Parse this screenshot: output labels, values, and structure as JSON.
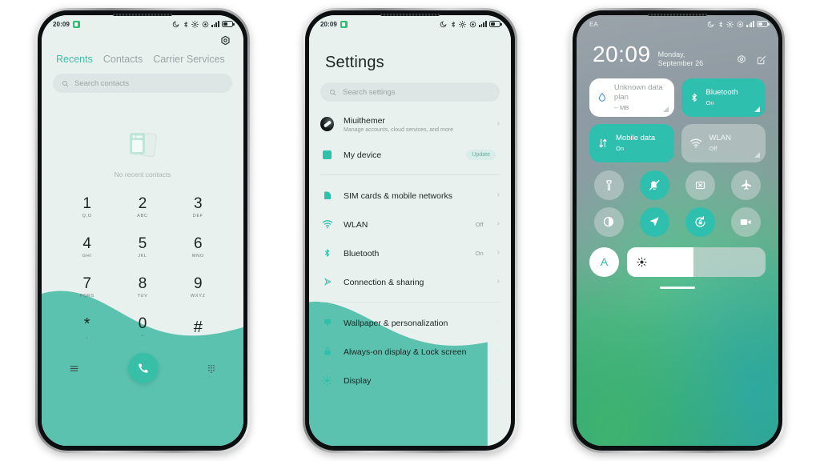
{
  "phone_dialer": {
    "status_bar": {
      "time": "20:09",
      "icons": [
        "dnd-moon-icon",
        "bluetooth-icon",
        "settings-gear-icon",
        "sync-ring-icon",
        "signal-bars-icon",
        "battery-icon"
      ]
    },
    "settings_gear_label": "settings-gear",
    "tabs": [
      {
        "label": "Recents",
        "active": true
      },
      {
        "label": "Contacts",
        "active": false
      },
      {
        "label": "Carrier Services",
        "active": false
      }
    ],
    "search_placeholder": "Search contacts",
    "empty_state": "No recent contacts",
    "keys": [
      {
        "num": "1",
        "sub": "Q,O"
      },
      {
        "num": "2",
        "sub": "ABC"
      },
      {
        "num": "3",
        "sub": "DEF"
      },
      {
        "num": "4",
        "sub": "GHI"
      },
      {
        "num": "5",
        "sub": "JKL"
      },
      {
        "num": "6",
        "sub": "MNO"
      },
      {
        "num": "7",
        "sub": "PQRS"
      },
      {
        "num": "8",
        "sub": "TUV"
      },
      {
        "num": "9",
        "sub": "WXYZ"
      },
      {
        "num": "*",
        "sub": ","
      },
      {
        "num": "0",
        "sub": "+"
      },
      {
        "num": "#",
        "sub": ""
      }
    ],
    "bottom_bar": {
      "menu": "menu-icon",
      "call": "call-icon",
      "keypad": "keypad-icon"
    }
  },
  "phone_settings": {
    "status_bar": {
      "time": "20:09"
    },
    "title": "Settings",
    "search_placeholder": "Search settings",
    "account": {
      "name": "Miuithemer",
      "subtitle": "Manage accounts, cloud services, and more"
    },
    "device": {
      "label": "My device",
      "badge": "Update"
    },
    "items": [
      {
        "label": "SIM cards & mobile networks",
        "value": "",
        "icon": "sim-card-icon"
      },
      {
        "label": "WLAN",
        "value": "Off",
        "icon": "wifi-icon"
      },
      {
        "label": "Bluetooth",
        "value": "On",
        "icon": "bluetooth-icon"
      },
      {
        "label": "Connection & sharing",
        "value": "",
        "icon": "connection-sharing-icon"
      }
    ],
    "items2": [
      {
        "label": "Wallpaper & personalization",
        "value": "",
        "icon": "wallpaper-icon"
      },
      {
        "label": "Always-on display & Lock screen",
        "value": "",
        "icon": "lock-icon"
      },
      {
        "label": "Display",
        "value": "",
        "icon": "brightness-icon"
      }
    ]
  },
  "phone_control_center": {
    "status_bar": {
      "carrier": "EA",
      "icons": [
        "dnd-moon-icon",
        "bluetooth-icon",
        "settings-gear-icon",
        "sync-ring-icon",
        "signal-bars-icon",
        "battery-icon"
      ]
    },
    "clock": "20:09",
    "date": "Monday, September 26",
    "header_icons": [
      "settings-gear-icon",
      "edit-icon"
    ],
    "tiles": [
      {
        "title": "Unknown data plan",
        "subtitle": "-- MB",
        "state": "white",
        "icon": "data-drop-icon"
      },
      {
        "title": "Bluetooth",
        "subtitle": "On",
        "state": "on",
        "icon": "bluetooth-icon"
      },
      {
        "title": "Mobile data",
        "subtitle": "On",
        "state": "on",
        "icon": "mobile-data-icon"
      },
      {
        "title": "WLAN",
        "subtitle": "Off",
        "state": "off",
        "icon": "wifi-icon"
      }
    ],
    "toggles": [
      {
        "name": "flashlight",
        "on": false
      },
      {
        "name": "silent-mode",
        "on": true
      },
      {
        "name": "cast-screen",
        "on": false
      },
      {
        "name": "airplane-mode",
        "on": false
      },
      {
        "name": "dark-mode",
        "on": false
      },
      {
        "name": "location",
        "on": true
      },
      {
        "name": "auto-rotate",
        "on": true
      },
      {
        "name": "screen-recorder",
        "on": false
      }
    ],
    "brightness": {
      "auto_label": "A",
      "level_percent": 48
    }
  },
  "colors": {
    "accent": "#38bfa8",
    "screen_bg": "#e9f1ef",
    "wave": "#5cc2b0",
    "text": "#1d2321",
    "muted": "#8e9b98"
  }
}
